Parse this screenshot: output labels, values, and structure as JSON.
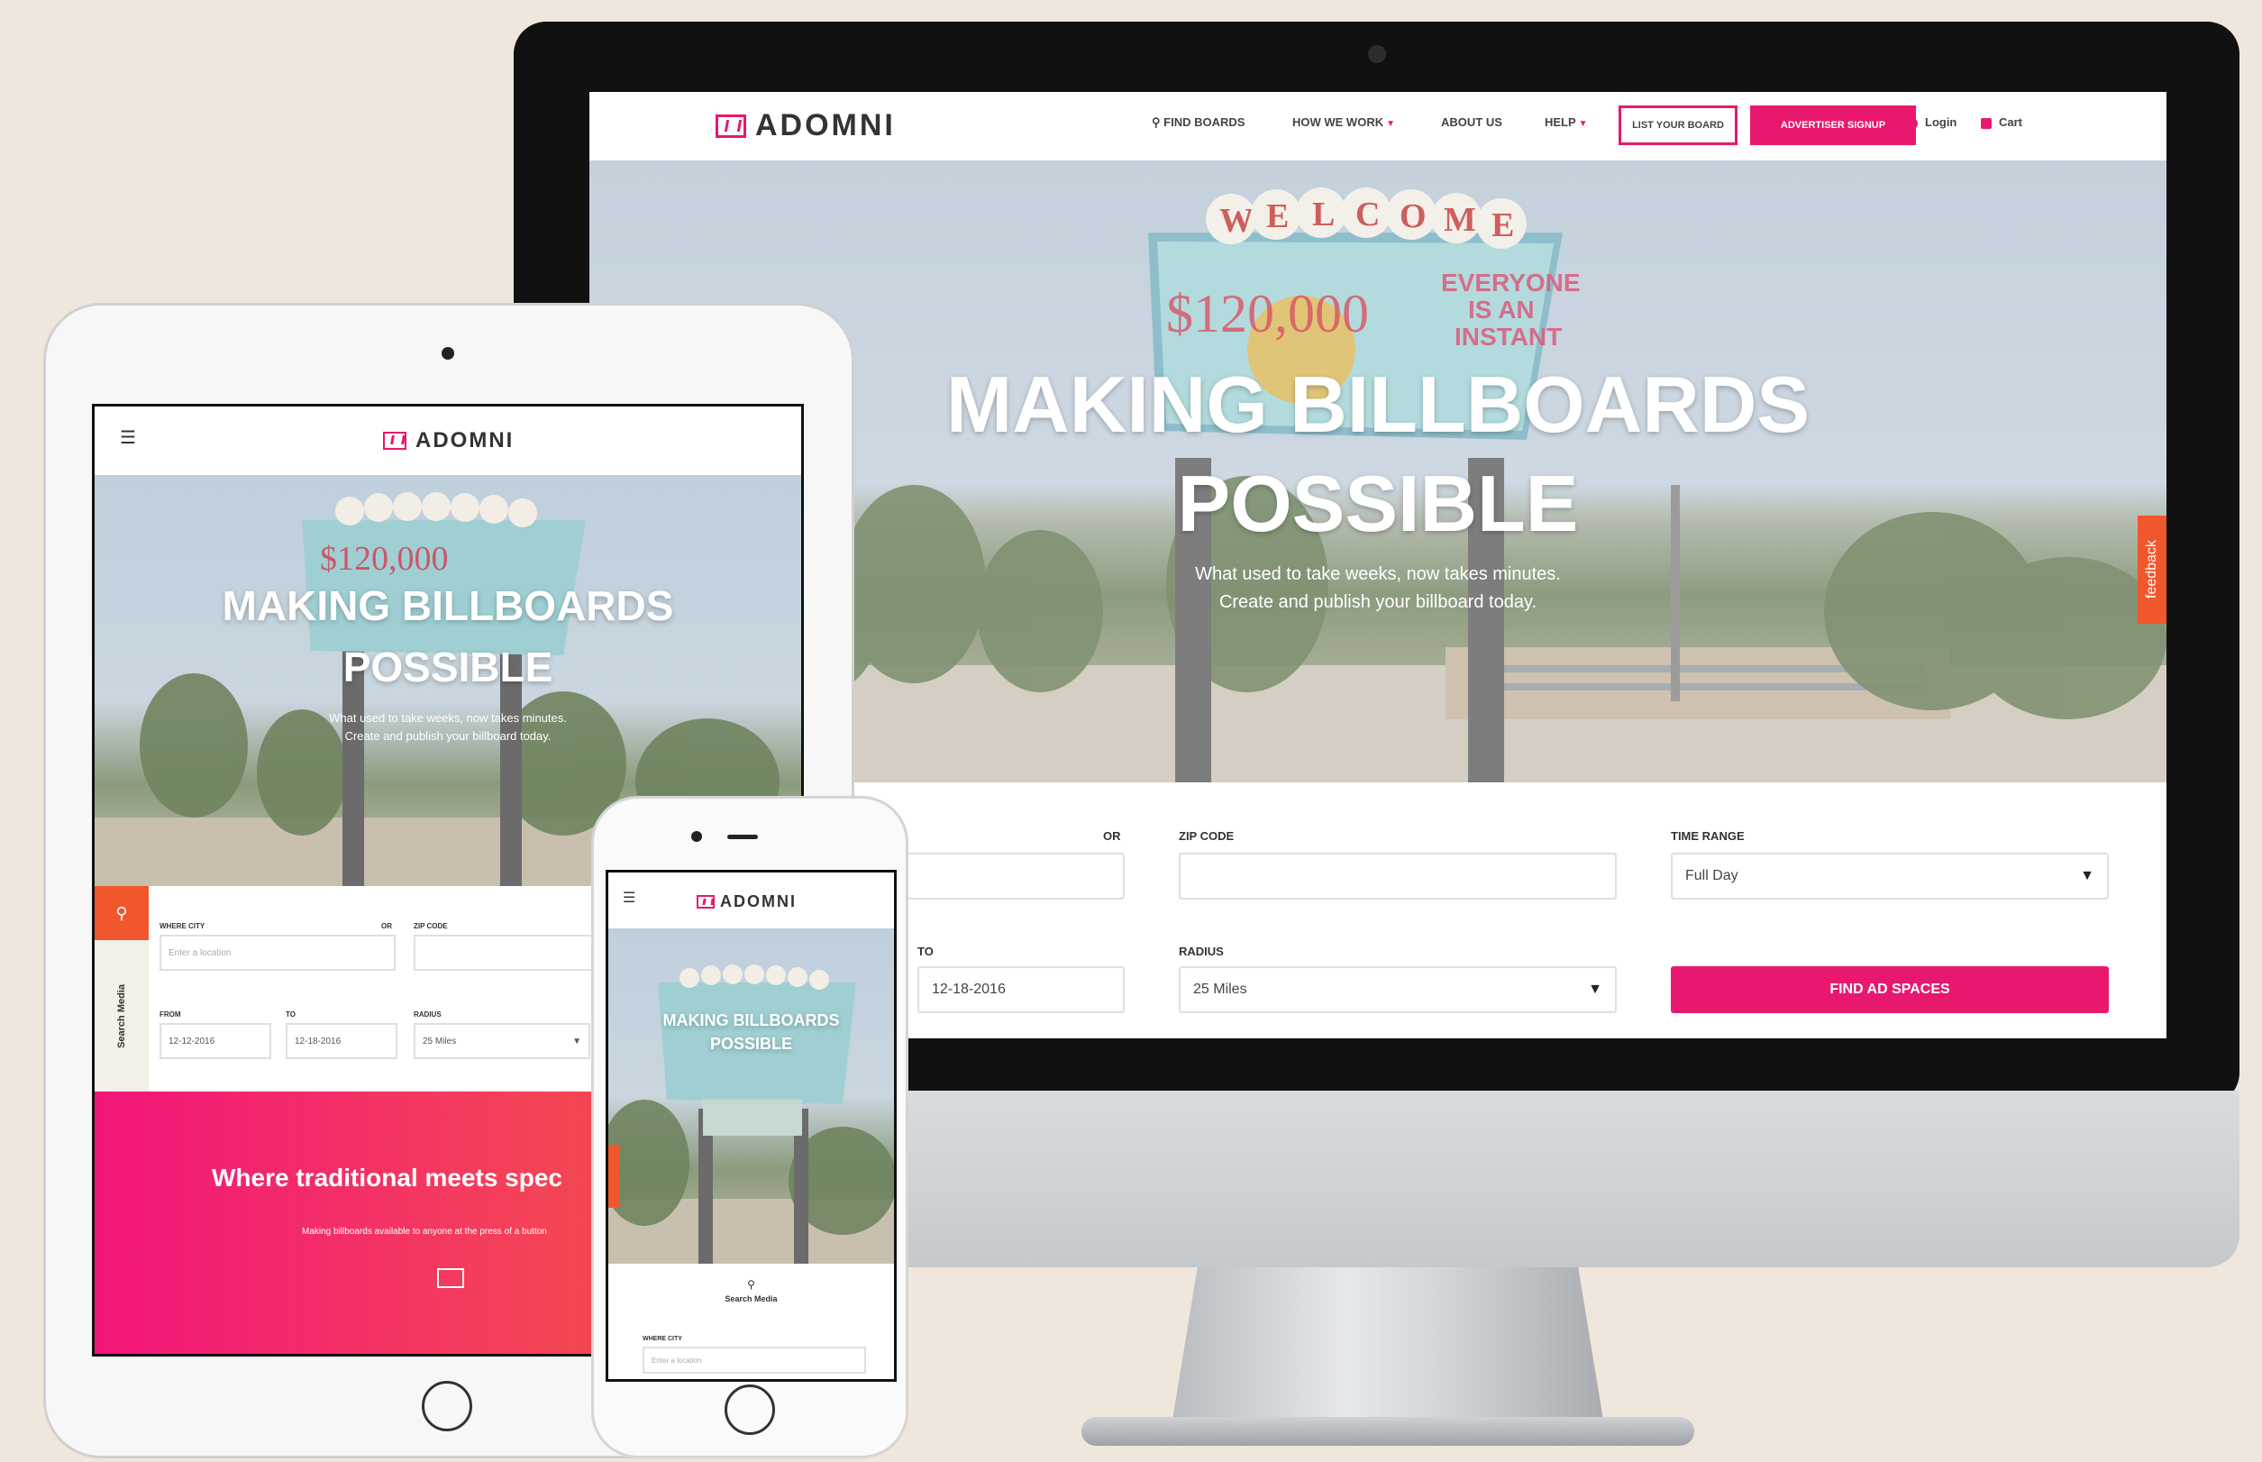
{
  "brand": {
    "name": "ADOMNI",
    "accent": "#e8186e",
    "feedback_color": "#f0572c"
  },
  "desktop": {
    "nav": {
      "find_boards": "FIND BOARDS",
      "how_we_work": "HOW WE WORK",
      "about_us": "ABOUT US",
      "help": "HELP",
      "list_your_board": "LIST YOUR BOARD",
      "advertiser_signup": "ADVERTISER SIGNUP",
      "login": "Login",
      "cart": "Cart"
    },
    "hero": {
      "title_line1": "MAKING BILLBOARDS",
      "title_line2": "POSSIBLE",
      "subtitle_line1": "What used to take weeks, now takes minutes.",
      "subtitle_line2": "Create and publish your billboard today."
    },
    "search": {
      "or_label": "OR",
      "zip_label": "ZIP CODE",
      "time_range_label": "TIME RANGE",
      "time_range_value": "Full Day",
      "to_label": "TO",
      "to_value": "12-18-2016",
      "radius_label": "RADIUS",
      "radius_value": "25 Miles",
      "find_button": "FIND AD SPACES"
    },
    "feedback": "feedback"
  },
  "tablet": {
    "hero": {
      "title_line1": "MAKING BILLBOARDS",
      "title_line2": "POSSIBLE",
      "subtitle_line1": "What used to take weeks, now takes minutes.",
      "subtitle_line2": "Create and publish your billboard today."
    },
    "search": {
      "side_tab": "Search Media",
      "where_label": "WHERE CITY",
      "or_label": "OR",
      "zip_label": "ZIP CODE",
      "where_placeholder": "Enter a location",
      "from_label": "FROM",
      "from_value": "12-12-2016",
      "to_label": "TO",
      "to_value": "12-18-2016",
      "radius_label": "RADIUS",
      "radius_value": "25 Miles"
    },
    "promo": {
      "headline": "Where traditional meets spec",
      "body": "Making billboards available to anyone at the press of a button"
    }
  },
  "phone": {
    "hero": {
      "title_line1": "MAKING BILLBOARDS",
      "title_line2": "POSSIBLE"
    },
    "search_media": "Search Media",
    "where_label": "WHERE CITY",
    "where_placeholder": "Enter a location"
  }
}
